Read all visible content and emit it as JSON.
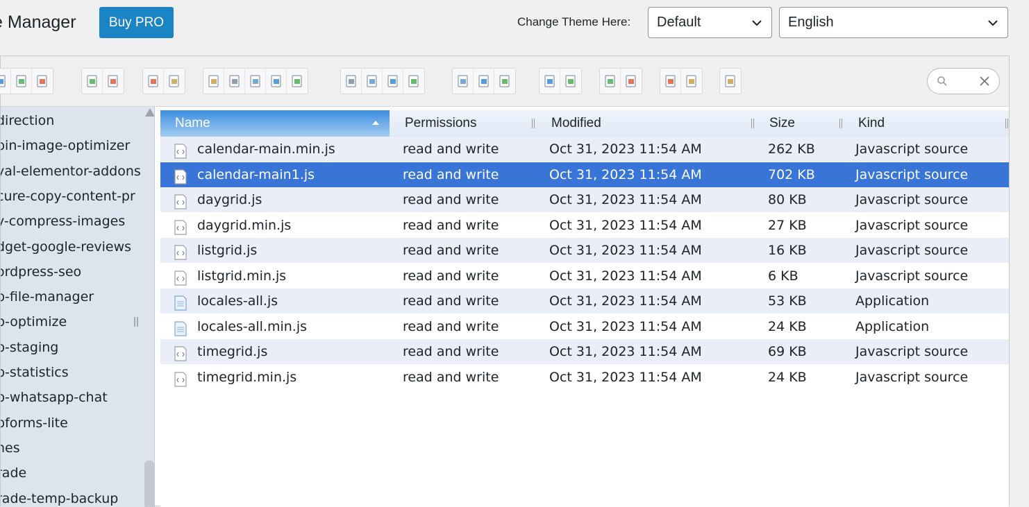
{
  "header": {
    "title": "e Manager",
    "buy_label": "Buy PRO",
    "theme_label": "Change Theme Here:",
    "theme_value": "Default",
    "language_value": "English"
  },
  "colors": {
    "accent": "#1a84c4",
    "selection": "#3875d7",
    "sidebar": "#dde4ee",
    "row_alt": "#e9eef8"
  },
  "toolbar": {
    "groups": [
      [
        "folder-up-icon",
        "new-file-icon",
        "save-icon"
      ],
      [
        "open-book-icon",
        "save-disk-icon"
      ],
      [
        "undo-icon",
        "redo-icon"
      ],
      [
        "copy-icon",
        "cut-icon",
        "paste-icon",
        "delete-icon",
        "empty-icon"
      ],
      [
        "duplicate-icon",
        "rename-icon",
        "edit-icon",
        "resize-icon"
      ],
      [
        "select-all-icon",
        "select-none-icon",
        "invert-select-icon"
      ],
      [
        "preview-icon",
        "info-icon"
      ],
      [
        "extract-icon",
        "archive-icon"
      ],
      [
        "icons-view-icon",
        "sort-icon"
      ],
      [
        "fullscreen-icon"
      ]
    ],
    "search_placeholder": ""
  },
  "sidebar": {
    "items": [
      "direction",
      "bin-image-optimizer",
      "yal-elementor-addons",
      "cure-copy-content-pr",
      "y-compress-images",
      "dget-google-reviews",
      "ordpress-seo",
      "p-file-manager",
      "p-optimize",
      "p-staging",
      "p-statistics",
      "p-whatsapp-chat",
      "pforms-lite",
      "nes",
      "rade",
      "rade-temp-backup"
    ]
  },
  "table": {
    "columns": {
      "name": "Name",
      "permissions": "Permissions",
      "modified": "Modified",
      "size": "Size",
      "kind": "Kind"
    },
    "rows": [
      {
        "name": "calendar-main.min.js",
        "perm": "read and write",
        "modified": "Oct 31, 2023 11:54 AM",
        "size": "262 KB",
        "kind": "Javascript source",
        "icon": "js-file-icon"
      },
      {
        "name": "calendar-main1.js",
        "perm": "read and write",
        "modified": "Oct 31, 2023 11:54 AM",
        "size": "702 KB",
        "kind": "Javascript source",
        "icon": "js-file-icon"
      },
      {
        "name": "daygrid.js",
        "perm": "read and write",
        "modified": "Oct 31, 2023 11:54 AM",
        "size": "80 KB",
        "kind": "Javascript source",
        "icon": "js-file-icon"
      },
      {
        "name": "daygrid.min.js",
        "perm": "read and write",
        "modified": "Oct 31, 2023 11:54 AM",
        "size": "27 KB",
        "kind": "Javascript source",
        "icon": "js-file-icon"
      },
      {
        "name": "listgrid.js",
        "perm": "read and write",
        "modified": "Oct 31, 2023 11:54 AM",
        "size": "16 KB",
        "kind": "Javascript source",
        "icon": "js-file-icon"
      },
      {
        "name": "listgrid.min.js",
        "perm": "read and write",
        "modified": "Oct 31, 2023 11:54 AM",
        "size": "6 KB",
        "kind": "Javascript source",
        "icon": "js-file-icon"
      },
      {
        "name": "locales-all.js",
        "perm": "read and write",
        "modified": "Oct 31, 2023 11:54 AM",
        "size": "53 KB",
        "kind": "Application",
        "icon": "app-file-icon"
      },
      {
        "name": "locales-all.min.js",
        "perm": "read and write",
        "modified": "Oct 31, 2023 11:54 AM",
        "size": "24 KB",
        "kind": "Application",
        "icon": "app-file-icon"
      },
      {
        "name": "timegrid.js",
        "perm": "read and write",
        "modified": "Oct 31, 2023 11:54 AM",
        "size": "69 KB",
        "kind": "Javascript source",
        "icon": "js-file-icon"
      },
      {
        "name": "timegrid.min.js",
        "perm": "read and write",
        "modified": "Oct 31, 2023 11:54 AM",
        "size": "24 KB",
        "kind": "Javascript source",
        "icon": "js-file-icon"
      }
    ]
  }
}
